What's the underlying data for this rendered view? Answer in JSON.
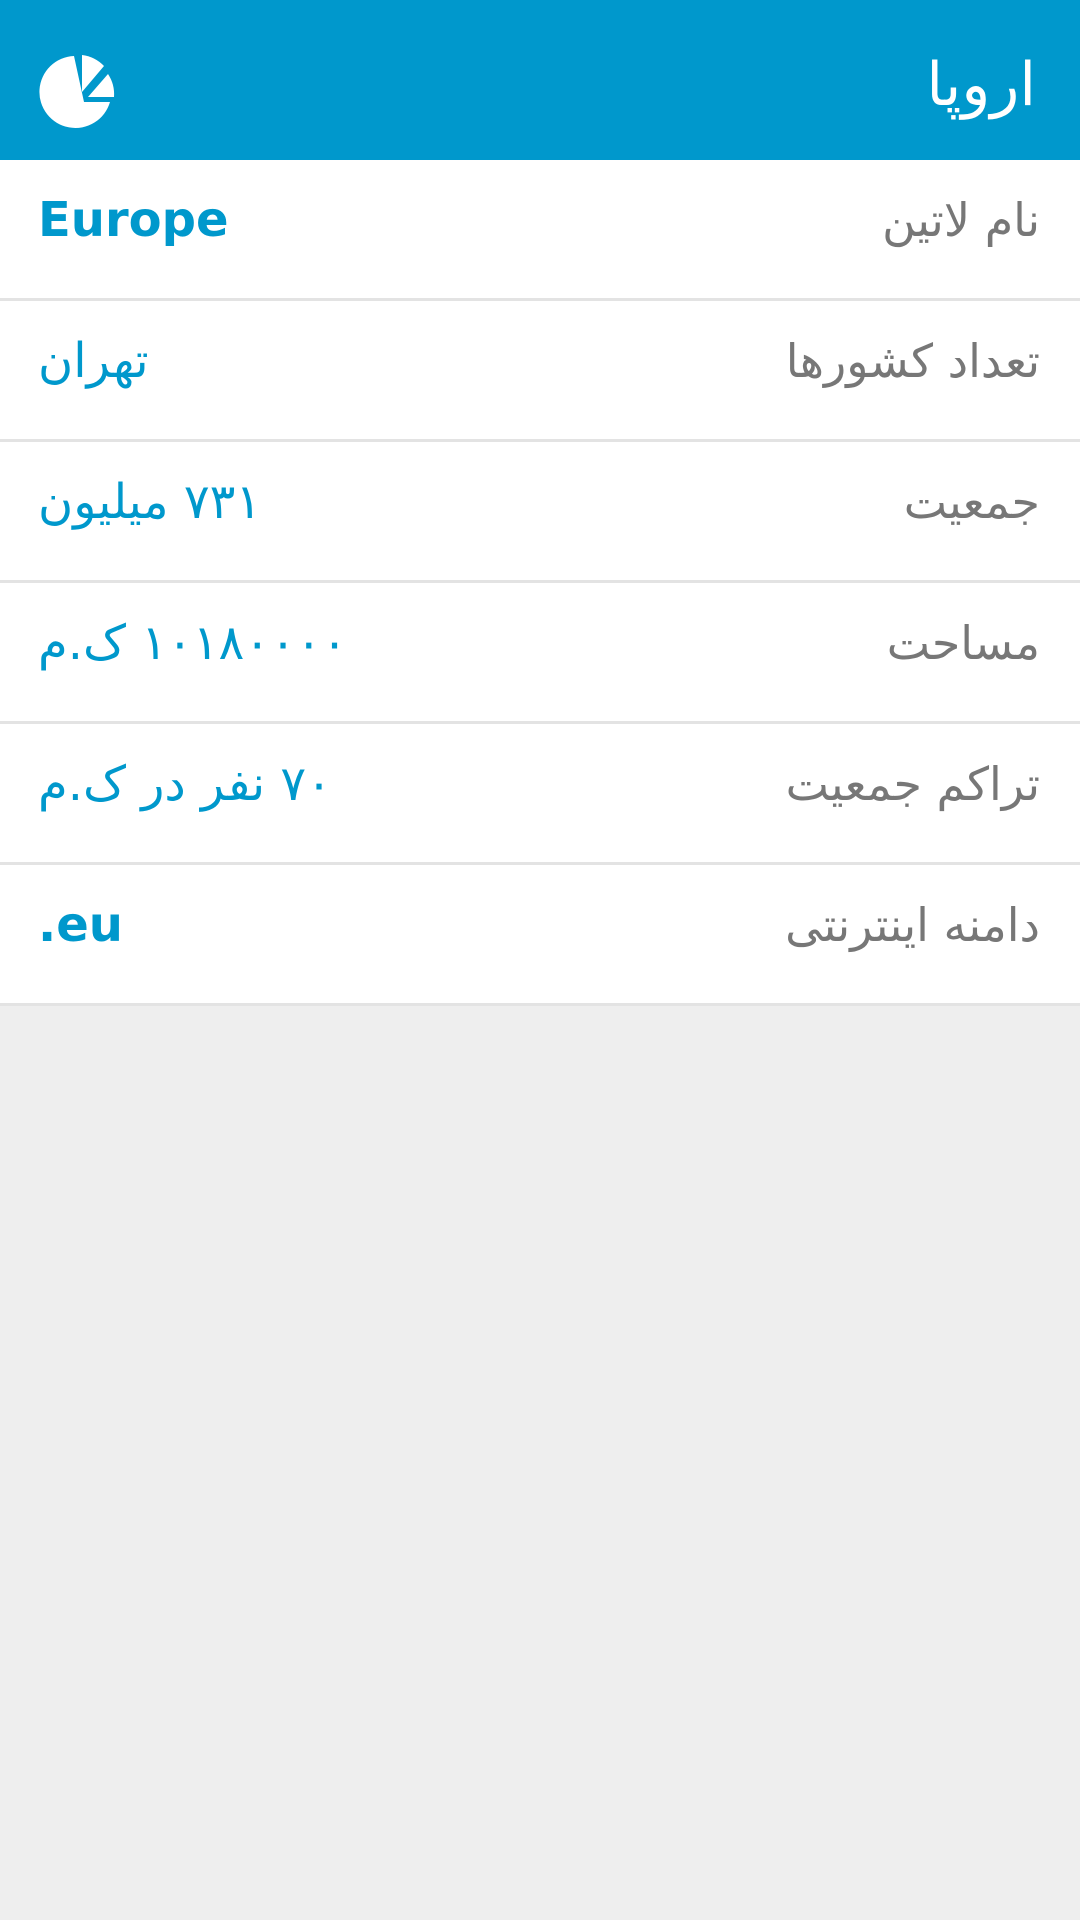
{
  "toolbar": {
    "title": "اروپا",
    "icon": "pie-chart-icon",
    "background": "#0098cc"
  },
  "rows": [
    {
      "label": "نام لاتین",
      "value": "Europe"
    },
    {
      "label": "تعداد کشورها",
      "value": "تهران"
    },
    {
      "label": "جمعیت",
      "value": "۷۳۱ میلیون"
    },
    {
      "label": "مساحت",
      "value": "۱۰۱۸۰۰۰۰ ک.م"
    },
    {
      "label": "تراکم جمعیت",
      "value": "۷۰ نفر در ک.م"
    },
    {
      "label": "دامنه اینترنتی",
      "value": ".eu"
    }
  ],
  "colors": {
    "accent": "#0098cc",
    "label": "#777777",
    "background": "#eeeeee"
  }
}
